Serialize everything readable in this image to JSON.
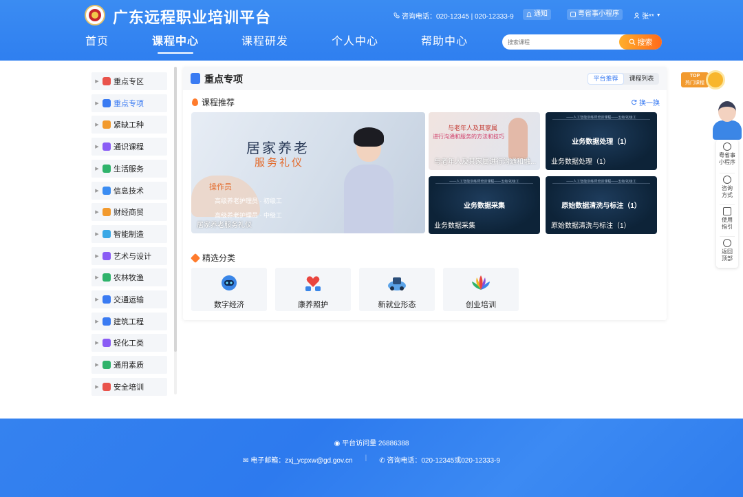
{
  "header": {
    "site_title": "广东远程职业培训平台",
    "hotline": "咨询电话：020-12345 | 020-12333-9",
    "notify_label": "通知",
    "mini_program_label": "粤省事小程序",
    "user_name": "张**"
  },
  "nav": {
    "items": [
      "首页",
      "课程中心",
      "课程研发",
      "个人中心",
      "帮助中心"
    ],
    "active": "课程中心"
  },
  "search": {
    "placeholder": "搜索课程",
    "button_label": "搜索"
  },
  "sidebar": {
    "items": [
      {
        "label": "重点专区",
        "icon": "heart-badge-icon",
        "color": "#e9534b"
      },
      {
        "label": "重点专项",
        "icon": "document-icon",
        "color": "#3a7bf2"
      },
      {
        "label": "紧缺工种",
        "icon": "worker-icon",
        "color": "#f29a2e"
      },
      {
        "label": "通识课程",
        "icon": "book-icon",
        "color": "#8a5cf5"
      },
      {
        "label": "生活服务",
        "icon": "leaf-hand-icon",
        "color": "#2fb36b"
      },
      {
        "label": "信息技术",
        "icon": "chip-icon",
        "color": "#3a8cf2"
      },
      {
        "label": "财经商贸",
        "icon": "money-bag-icon",
        "color": "#f29a2e"
      },
      {
        "label": "智能制造",
        "icon": "robot-arm-icon",
        "color": "#3aa8e6"
      },
      {
        "label": "艺术与设计",
        "icon": "palette-icon",
        "color": "#8a5cf5"
      },
      {
        "label": "农林牧渔",
        "icon": "sprout-icon",
        "color": "#2fb36b"
      },
      {
        "label": "交通运输",
        "icon": "truck-icon",
        "color": "#3a7bf2"
      },
      {
        "label": "建筑工程",
        "icon": "building-icon",
        "color": "#3a7bf2"
      },
      {
        "label": "轻化工类",
        "icon": "flask-icon",
        "color": "#8a5cf5"
      },
      {
        "label": "通用素质",
        "icon": "home-badge-icon",
        "color": "#2fb36b"
      },
      {
        "label": "安全培训",
        "icon": "shield-icon",
        "color": "#e9534b"
      }
    ],
    "active": "重点专项"
  },
  "panel": {
    "title": "重点专项",
    "toggle": [
      "平台推荐",
      "课程列表"
    ],
    "toggle_active": "平台推荐",
    "recommend_title": "课程推荐",
    "refresh_label": "换一换",
    "courses": [
      {
        "caption": "居家养老服务礼仪",
        "cover_title": "居家养老",
        "cover_subtitle": "服务礼仪",
        "cover_role": "操作员",
        "cover_line1": "高级养老护理员 · 初级工",
        "cover_line2": "高级养老护理员 · 中级工"
      },
      {
        "caption": "与老年人及其家属进行沟通和融...",
        "cover_title": "与老年人及其家属",
        "cover_subtitle": "进行沟通和服务的方法和技巧"
      },
      {
        "caption": "业务数据处理（1）",
        "cover_title": "业务数据处理（1）",
        "cover_small": "——人工智能训练师培训课程——五级/初级工"
      },
      {
        "caption": "业务数据采集",
        "cover_title": "业务数据采集",
        "cover_small": "——人工智能训练师培训课程——五级/初级工"
      },
      {
        "caption": "原始数据清洗与标注（1）",
        "cover_title": "原始数据清洗与标注（1）",
        "cover_small": "——人工智能训练师培训课程——五级/初级工"
      }
    ],
    "category_title": "精选分类",
    "categories": [
      {
        "label": "数字经济",
        "icon": "robot-icon"
      },
      {
        "label": "康养照护",
        "icon": "heart-hands-icon"
      },
      {
        "label": "新就业形态",
        "icon": "delivery-icon"
      },
      {
        "label": "创业培训",
        "icon": "lotus-icon"
      }
    ]
  },
  "floating": {
    "top_badge": [
      "TOP",
      "热门课程"
    ],
    "items": [
      {
        "label": "粤省事小程序",
        "icon": "mini-program-icon"
      },
      {
        "label": "咨询方式",
        "icon": "headset-icon"
      },
      {
        "label": "使用指引",
        "icon": "guide-icon"
      },
      {
        "label": "返回顶部",
        "icon": "arrow-up-icon"
      }
    ]
  },
  "footer": {
    "visits_label": "平台访问量",
    "visits_value": "26886388",
    "email": "电子邮箱：zxj_ycpxw@gd.gov.cn",
    "phone": "咨询电话：020-12345或020-12333-9"
  },
  "colors": {
    "brand_blue": "#2f7ff0",
    "accent_orange": "#ff7b2c",
    "active_text": "#3a7bf2"
  }
}
